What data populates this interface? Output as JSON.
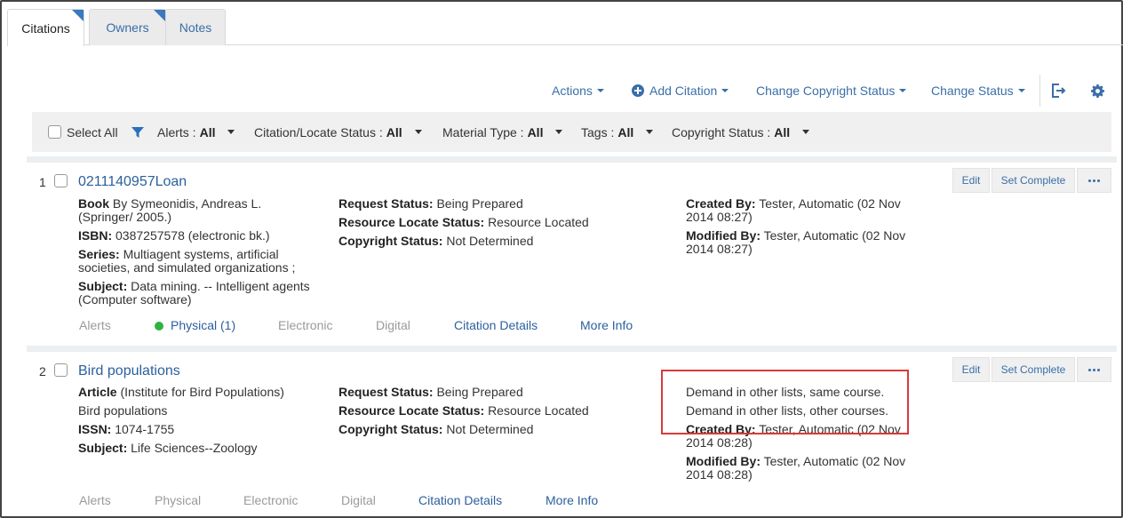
{
  "tabs": [
    {
      "label": "Citations",
      "active": true,
      "flag": true
    },
    {
      "label": "Owners",
      "active": false,
      "flag": true
    },
    {
      "label": "Notes",
      "active": false,
      "flag": false
    }
  ],
  "actions": {
    "actions_label": "Actions",
    "add_citation_label": "Add Citation",
    "change_copyright_label": "Change Copyright Status",
    "change_status_label": "Change Status",
    "export_icon": "export-icon",
    "settings_icon": "gear-icon"
  },
  "filters": {
    "select_all": "Select All",
    "alerts_label": "Alerts :",
    "alerts_value": "All",
    "citation_status_label": "Citation/Locate Status :",
    "citation_status_value": "All",
    "material_type_label": "Material Type :",
    "material_type_value": "All",
    "tags_label": "Tags :",
    "tags_value": "All",
    "copyright_label": "Copyright Status :",
    "copyright_value": "All"
  },
  "colors": {
    "link": "#2c5f9e",
    "flag": "#3a78c0",
    "highlight": "#d93a3a",
    "status_dot": "#2fb344"
  },
  "citations": [
    {
      "number": "1",
      "title": "0211140957Loan",
      "type_label": "Book",
      "type_rest": "By Symeonidis, Andreas L. (Springer/ 2005.)",
      "id_label": "ISBN:",
      "id_value": "0387257578 (electronic bk.)",
      "series_label": "Series:",
      "series_value": "Multiagent systems, artificial societies, and simulated organizations ;",
      "subject_label": "Subject:",
      "subject_value": "Data mining. -- Intelligent agents (Computer software)",
      "request_status_label": "Request Status:",
      "request_status_value": "Being Prepared",
      "locate_status_label": "Resource Locate Status:",
      "locate_status_value": "Resource Located",
      "copyright_status_label": "Copyright Status:",
      "copyright_status_value": "Not Determined",
      "created_by_label": "Created By:",
      "created_by_value": "Tester, Automatic (02 Nov 2014 08:27)",
      "modified_by_label": "Modified By:",
      "modified_by_value": "Tester, Automatic (02 Nov 2014 08:27)",
      "edit_label": "Edit",
      "set_complete_label": "Set Complete",
      "links": {
        "alerts": "Alerts",
        "physical": "Physical (1)",
        "electronic": "Electronic",
        "digital": "Digital",
        "details": "Citation Details",
        "more": "More Info"
      }
    },
    {
      "number": "2",
      "title": "Bird populations",
      "type_label": "Article",
      "type_rest": "(Institute for Bird Populations)",
      "journal": "Bird populations",
      "id_label": "ISSN:",
      "id_value": "1074-1755",
      "subject_label": "Subject:",
      "subject_value": "Life Sciences--Zoology",
      "request_status_label": "Request Status:",
      "request_status_value": "Being Prepared",
      "locate_status_label": "Resource Locate Status:",
      "locate_status_value": "Resource Located",
      "copyright_status_label": "Copyright Status:",
      "copyright_status_value": "Not Determined",
      "demand_same": "Demand in other lists, same course.",
      "demand_other": "Demand in other lists, other courses.",
      "created_by_label": "Created By:",
      "created_by_value": "Tester, Automatic (02 Nov 2014 08:28)",
      "modified_by_label": "Modified By:",
      "modified_by_value": "Tester, Automatic (02 Nov 2014 08:28)",
      "edit_label": "Edit",
      "set_complete_label": "Set Complete",
      "links": {
        "alerts": "Alerts",
        "physical": "Physical",
        "electronic": "Electronic",
        "digital": "Digital",
        "details": "Citation Details",
        "more": "More Info"
      }
    }
  ]
}
